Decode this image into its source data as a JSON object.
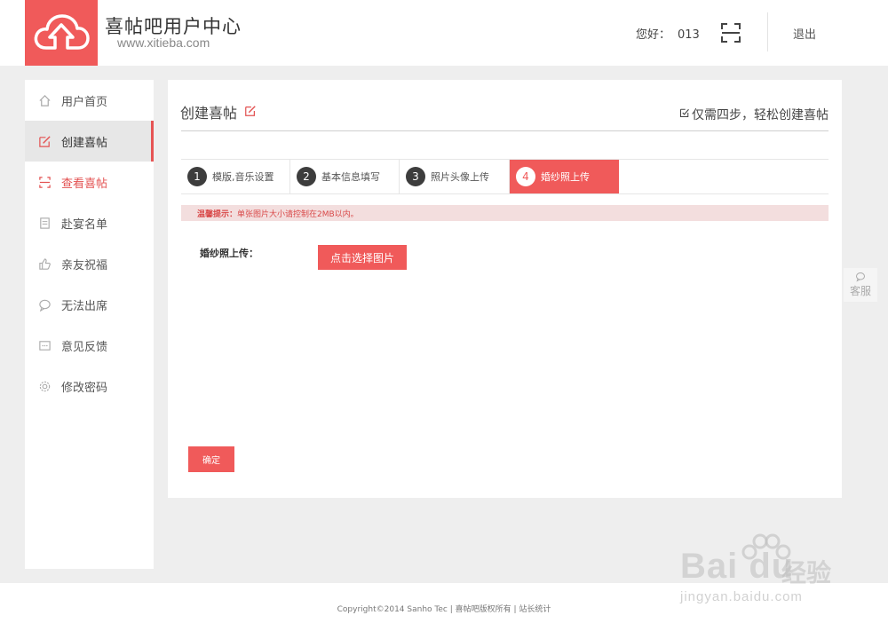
{
  "header": {
    "brand_title": "喜帖吧用户中心",
    "brand_url": "www.xitieba.com",
    "greeting": "您好：",
    "username": "013",
    "logout": "退出"
  },
  "sidebar": {
    "items": [
      {
        "label": "用户首页",
        "icon": "home-icon"
      },
      {
        "label": "创建喜帖",
        "icon": "edit-icon"
      },
      {
        "label": "查看喜帖",
        "icon": "scan-frame-icon"
      },
      {
        "label": "赴宴名单",
        "icon": "list-icon"
      },
      {
        "label": "亲友祝福",
        "icon": "thumbs-up-icon"
      },
      {
        "label": "无法出席",
        "icon": "chat-icon"
      },
      {
        "label": "意见反馈",
        "icon": "feedback-icon"
      },
      {
        "label": "修改密码",
        "icon": "gear-icon"
      }
    ],
    "active_index": 1,
    "highlight_index": 2
  },
  "main": {
    "title": "创建喜帖",
    "hint": "仅需四步，轻松创建喜帖",
    "steps": [
      {
        "num": "1",
        "label": "模版,音乐设置"
      },
      {
        "num": "2",
        "label": "基本信息填写"
      },
      {
        "num": "3",
        "label": "照片头像上传"
      },
      {
        "num": "4",
        "label": "婚纱照上传"
      }
    ],
    "active_step": 4,
    "tip_label": "温馨提示：",
    "tip_text": "单张图片大小请控制在2MB以内。",
    "upload_label": "婚纱照上传：",
    "upload_button": "点击选择图片",
    "confirm_button": "确定"
  },
  "customer_service": "客服",
  "footer": {
    "copyright": "Copyright©2014 Sanho Tec | 喜帖吧版权所有 | 站长统计"
  },
  "watermark": {
    "brand": "Bai du",
    "brand_cn": "经验",
    "url": "jingyan.baidu.com"
  },
  "colors": {
    "accent": "#f05a5a",
    "active_bar": "#e65454",
    "tip_bg": "#f3dede",
    "step_circle": "#3d3d3d"
  }
}
